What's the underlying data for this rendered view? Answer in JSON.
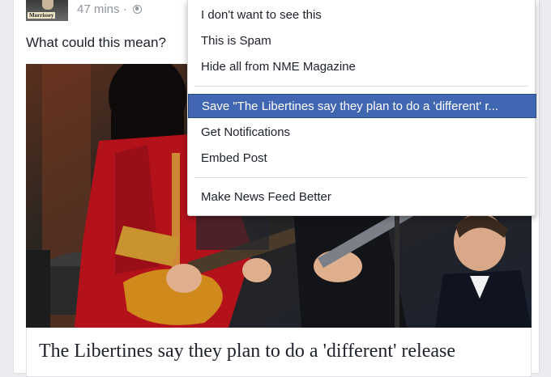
{
  "post": {
    "avatar_label": "Morrissey",
    "timestamp": "47 mins ·",
    "privacy_icon": "globe-icon",
    "text": "What could this mean?",
    "link_title": "The Libertines say they plan to do a 'different' release"
  },
  "menu": {
    "items": [
      {
        "label": "I don't want to see this"
      },
      {
        "label": "This is Spam"
      },
      {
        "label": "Hide all from NME Magazine"
      },
      {
        "label": "Save \"The Libertines say they plan to do a 'different' r..."
      },
      {
        "label": "Get Notifications"
      },
      {
        "label": "Embed Post"
      },
      {
        "label": "Make News Feed Better"
      }
    ],
    "highlight_color": "#4267b2"
  }
}
